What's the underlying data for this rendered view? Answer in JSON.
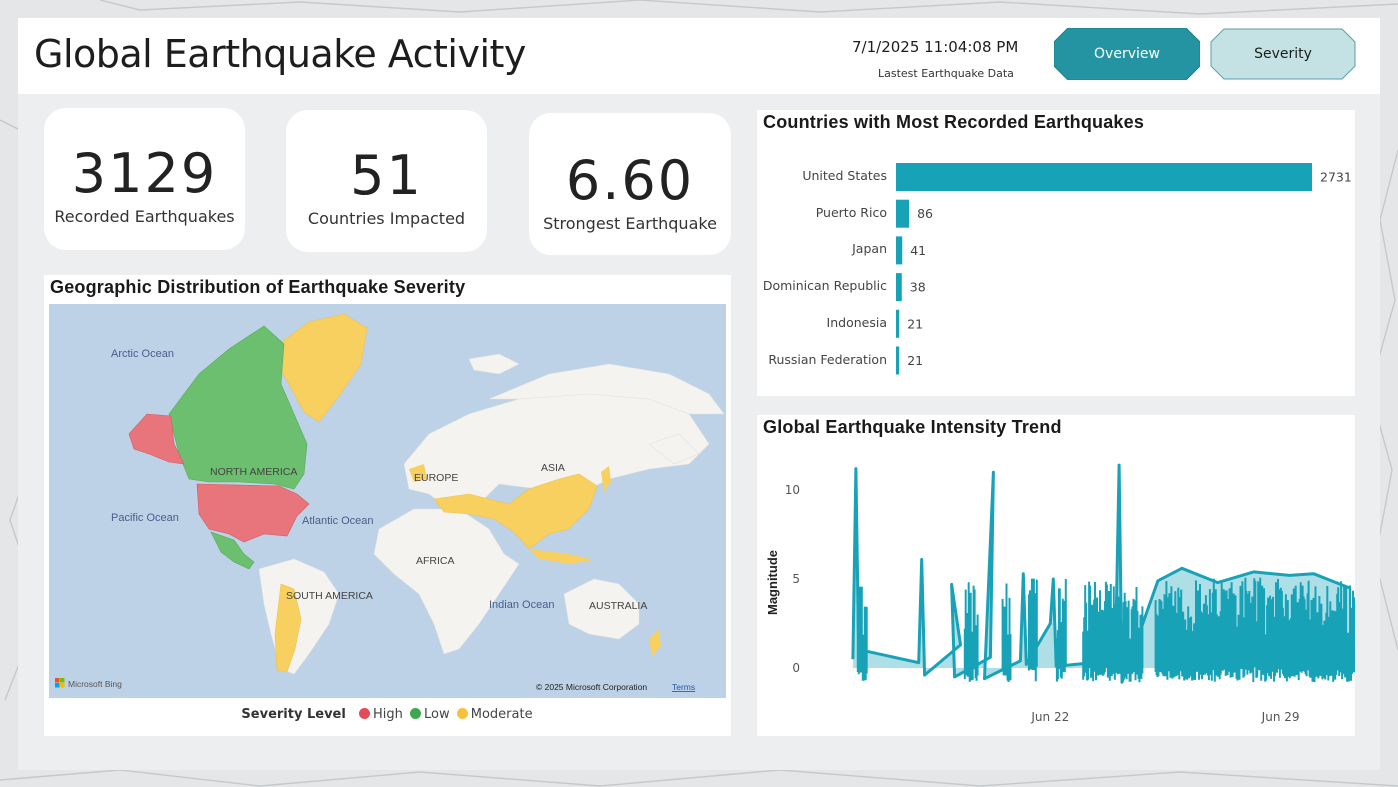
{
  "header": {
    "title": "Global Earthquake Activity",
    "timestamp": "7/1/2025 11:04:08 PM",
    "timestamp_label": "Lastest Earthquake Data",
    "nav": [
      {
        "label": "Overview",
        "active": true
      },
      {
        "label": "Severity",
        "active": false
      }
    ]
  },
  "kpis": [
    {
      "value": "3129",
      "label": "Recorded Earthquakes"
    },
    {
      "value": "51",
      "label": "Countries Impacted"
    },
    {
      "value": "6.60",
      "label": "Strongest Earthquake"
    }
  ],
  "map": {
    "title": "Geographic Distribution of Earthquake Severity",
    "labels": {
      "arctic": "Arctic Ocean",
      "north_america": "NORTH AMERICA",
      "europe": "EUROPE",
      "asia": "ASIA",
      "pacific": "Pacific Ocean",
      "atlantic": "Atlantic Ocean",
      "africa": "AFRICA",
      "south_america": "SOUTH AMERICA",
      "indian": "Indian Ocean",
      "australia": "AUSTRALIA"
    },
    "attribution": "Microsoft Bing",
    "copyright": "© 2025 Microsoft Corporation",
    "terms": "Terms",
    "legend": {
      "title": "Severity Level",
      "items": [
        {
          "label": "High",
          "color": "#e04b57"
        },
        {
          "label": "Low",
          "color": "#3ea64e"
        },
        {
          "label": "Moderate",
          "color": "#f5c13f"
        }
      ]
    },
    "colors": {
      "ocean": "#bdd2e7",
      "land": "#f4f3f0",
      "high": "#e8747c",
      "low": "#6cbf6e",
      "moderate": "#f7d060"
    }
  },
  "chart_data": [
    {
      "type": "bar",
      "title": "Countries with Most Recorded Earthquakes",
      "orientation": "horizontal",
      "categories": [
        "United States",
        "Puerto Rico",
        "Japan",
        "Dominican Republic",
        "Indonesia",
        "Russian Federation"
      ],
      "values": [
        2731,
        86,
        41,
        38,
        21,
        21
      ],
      "color": "#18a2b8"
    },
    {
      "type": "area",
      "title": "Global Earthquake Intensity Trend",
      "ylabel": "Magnitude",
      "yticks": [
        0,
        5,
        10
      ],
      "ylim": [
        -1,
        12
      ],
      "xticks": [
        "Jun 22",
        "Jun 29"
      ],
      "color": "#18a2b8",
      "series": [
        {
          "values": [
            {
              "x": "2025-06-16",
              "y": 0.5
            },
            {
              "x": "2025-06-16",
              "y": 11.2
            },
            {
              "x": "2025-06-16",
              "y": 0.4
            },
            {
              "x": "2025-06-16",
              "y": 1.0
            },
            {
              "x": "2025-06-18",
              "y": 0.3
            },
            {
              "x": "2025-06-18",
              "y": 6.1
            },
            {
              "x": "2025-06-18",
              "y": -0.4
            },
            {
              "x": "2025-06-19",
              "y": 1.3
            },
            {
              "x": "2025-06-19",
              "y": 4.7
            },
            {
              "x": "2025-06-19",
              "y": -0.5
            },
            {
              "x": "2025-06-20",
              "y": 0.6
            },
            {
              "x": "2025-06-20",
              "y": 11.0
            },
            {
              "x": "2025-06-20",
              "y": -0.6
            },
            {
              "x": "2025-06-21",
              "y": 0.4
            },
            {
              "x": "2025-06-21",
              "y": 5.3
            },
            {
              "x": "2025-06-21",
              "y": 0.2
            },
            {
              "x": "2025-06-22",
              "y": 2.5
            },
            {
              "x": "2025-06-22",
              "y": 5.0
            },
            {
              "x": "2025-06-22",
              "y": 0.1
            },
            {
              "x": "2025-06-23",
              "y": 0.3
            },
            {
              "x": "2025-06-24",
              "y": 2.5
            },
            {
              "x": "2025-06-24",
              "y": 11.4
            },
            {
              "x": "2025-06-24",
              "y": -0.8
            },
            {
              "x": "2025-06-25",
              "y": 4.9
            },
            {
              "x": "2025-06-26",
              "y": 5.6
            },
            {
              "x": "2025-06-27",
              "y": 4.8
            },
            {
              "x": "2025-06-28",
              "y": 5.4
            },
            {
              "x": "2025-06-29",
              "y": 5.2
            },
            {
              "x": "2025-06-30",
              "y": 5.3
            },
            {
              "x": "2025-07-01",
              "y": 4.5
            }
          ]
        }
      ]
    }
  ]
}
